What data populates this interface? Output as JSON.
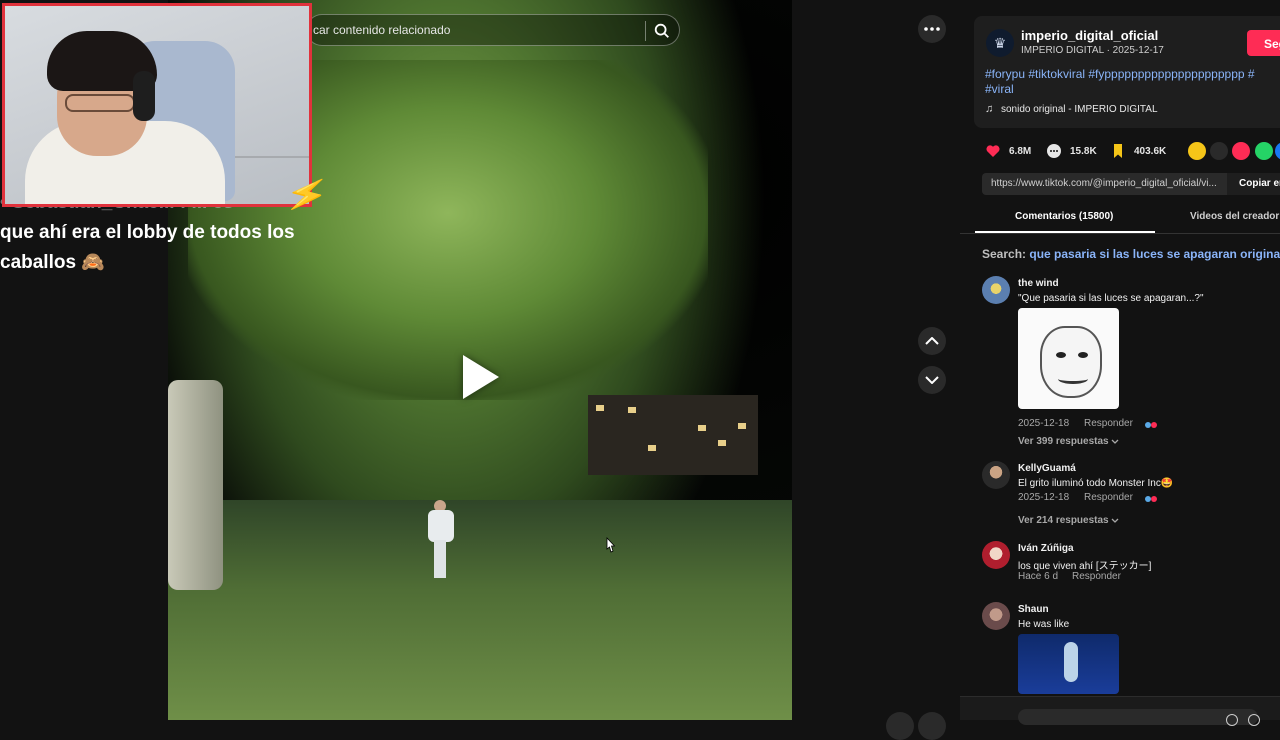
{
  "overlay": {
    "chat_line_top": "• Sebastian_Chac... : ... es",
    "chat_line_1": "que ahí era el lobby de todos los",
    "chat_line_2": "caballos 🙈"
  },
  "video": {
    "search_placeholder": "car contenido relacionado"
  },
  "creator": {
    "handle": "imperio_digital_oficial",
    "meta": "IMPERIO DIGITAL · 2025-12-17",
    "follow_label": "Seg",
    "hashtags_line1": "#forypu #tiktokviral #fyppppppppppppppppppppp #",
    "hashtags_line2": "#viral",
    "music": "sonido original - IMPERIO DIGITAL"
  },
  "stats": {
    "likes": "6.8M",
    "comments": "15.8K",
    "saves": "403.6K"
  },
  "share": {
    "url": "https://www.tiktok.com/@imperio_digital_oficial/vi...",
    "copy_label": "Copiar en"
  },
  "tabs": {
    "comments": "Comentarios (15800)",
    "creator_videos": "Videos del creador"
  },
  "search": {
    "prefix": "Search:",
    "query": "que pasaria si las luces se apagaran original"
  },
  "comments": [
    {
      "user": "the wind",
      "text": "\"Que pasaria si las luces se apagaran...?\"",
      "date": "2025-12-18",
      "reply": "Responder",
      "replies": "Ver 399 respuestas"
    },
    {
      "user": "KellyGuamá",
      "text": "El grito iluminó todo Monster Inc🤩",
      "date": "2025-12-18",
      "reply": "Responder",
      "replies": "Ver 214 respuestas"
    },
    {
      "user": "Iván Zúñiga",
      "text": "los que viven ahí [ステッカー]",
      "date": "Hace 6 d",
      "reply": "Responder"
    },
    {
      "user": "Shaun",
      "text": "He was like"
    }
  ],
  "colors": {
    "accent": "#fe2c55",
    "link": "#8ab4f8",
    "webcam_border": "#e0323c"
  }
}
